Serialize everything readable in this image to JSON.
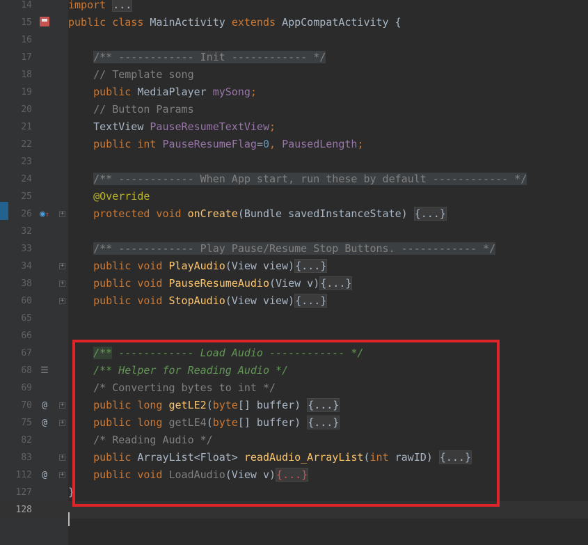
{
  "editor": {
    "colors": {
      "background": "#2b2b2b",
      "gutter": "#313335",
      "keyword": "#cc7832",
      "field": "#9876aa",
      "method": "#ffc66d",
      "comment": "#808080",
      "doc_comment": "#629755",
      "annotation": "#bbb529",
      "number": "#6897bb",
      "highlight_box": "#e0252a"
    },
    "lines": [
      {
        "num": "14",
        "segments": [
          {
            "t": "import ",
            "c": "kw"
          },
          {
            "t": "...",
            "c": "folded"
          }
        ]
      },
      {
        "num": "15",
        "icon": "vcs-class-icon",
        "segments": [
          {
            "t": "public class ",
            "c": "kw"
          },
          {
            "t": "MainActivity ",
            "c": "id"
          },
          {
            "t": "extends ",
            "c": "kw"
          },
          {
            "t": "AppCompatActivity {",
            "c": "id"
          }
        ]
      },
      {
        "num": "16",
        "segments": []
      },
      {
        "num": "17",
        "segments": [
          {
            "t": "    ",
            "c": "id"
          },
          {
            "t": "/** ------------ Init ------------ */",
            "c": "cm hl"
          }
        ]
      },
      {
        "num": "18",
        "segments": [
          {
            "t": "    ",
            "c": "id"
          },
          {
            "t": "// Template song",
            "c": "cm"
          }
        ]
      },
      {
        "num": "19",
        "segments": [
          {
            "t": "    ",
            "c": "id"
          },
          {
            "t": "public ",
            "c": "kw"
          },
          {
            "t": "MediaPlayer ",
            "c": "id"
          },
          {
            "t": "mySong",
            "c": "fld"
          },
          {
            "t": ";",
            "c": "kw"
          }
        ]
      },
      {
        "num": "20",
        "segments": [
          {
            "t": "    ",
            "c": "id"
          },
          {
            "t": "// Button Params",
            "c": "cm"
          }
        ]
      },
      {
        "num": "21",
        "segments": [
          {
            "t": "    ",
            "c": "id"
          },
          {
            "t": "TextView ",
            "c": "id"
          },
          {
            "t": "PauseResumeTextView",
            "c": "fld"
          },
          {
            "t": ";",
            "c": "kw"
          }
        ]
      },
      {
        "num": "22",
        "segments": [
          {
            "t": "    ",
            "c": "id"
          },
          {
            "t": "public int ",
            "c": "kw"
          },
          {
            "t": "PauseResumeFlag",
            "c": "fld"
          },
          {
            "t": "=",
            "c": "id"
          },
          {
            "t": "0",
            "c": "num"
          },
          {
            "t": ", ",
            "c": "kw"
          },
          {
            "t": "PausedLength",
            "c": "fld"
          },
          {
            "t": ";",
            "c": "kw"
          }
        ]
      },
      {
        "num": "23",
        "segments": []
      },
      {
        "num": "24",
        "segments": [
          {
            "t": "    ",
            "c": "id"
          },
          {
            "t": "/** ------------ When App start, run these by default ------------ */",
            "c": "cm hl"
          }
        ]
      },
      {
        "num": "25",
        "segments": [
          {
            "t": "    ",
            "c": "id"
          },
          {
            "t": "@Override",
            "c": "ann"
          }
        ]
      },
      {
        "num": "26",
        "icon": "override-up-icon",
        "fold": true,
        "segments": [
          {
            "t": "    ",
            "c": "id"
          },
          {
            "t": "protected void ",
            "c": "kw"
          },
          {
            "t": "onCreate",
            "c": "mth"
          },
          {
            "t": "(Bundle savedInstanceState) ",
            "c": "id"
          },
          {
            "t": "{...}",
            "c": "folded"
          }
        ]
      },
      {
        "num": "32",
        "segments": []
      },
      {
        "num": "33",
        "segments": [
          {
            "t": "    ",
            "c": "id"
          },
          {
            "t": "/** ------------ Play Pause/Resume Stop Buttons. ------------ */",
            "c": "cm hl"
          }
        ]
      },
      {
        "num": "34",
        "fold": true,
        "segments": [
          {
            "t": "    ",
            "c": "id"
          },
          {
            "t": "public void ",
            "c": "kw"
          },
          {
            "t": "PlayAudio",
            "c": "mth"
          },
          {
            "t": "(View view)",
            "c": "id"
          },
          {
            "t": "{...}",
            "c": "folded"
          }
        ]
      },
      {
        "num": "38",
        "fold": true,
        "segments": [
          {
            "t": "    ",
            "c": "id"
          },
          {
            "t": "public void ",
            "c": "kw"
          },
          {
            "t": "PauseResumeAudio",
            "c": "mth"
          },
          {
            "t": "(View v)",
            "c": "id"
          },
          {
            "t": "{...}",
            "c": "folded"
          }
        ]
      },
      {
        "num": "60",
        "fold": true,
        "segments": [
          {
            "t": "    ",
            "c": "id"
          },
          {
            "t": "public void ",
            "c": "kw"
          },
          {
            "t": "StopAudio",
            "c": "mth"
          },
          {
            "t": "(View view)",
            "c": "id"
          },
          {
            "t": "{...}",
            "c": "folded"
          }
        ]
      },
      {
        "num": "65",
        "segments": []
      },
      {
        "num": "66",
        "segments": []
      },
      {
        "num": "67",
        "segments": [
          {
            "t": "    ",
            "c": "id"
          },
          {
            "t": "/**",
            "c": "doc mlink"
          },
          {
            "t": " ------------ Load Audio ------------ */",
            "c": "doc"
          }
        ]
      },
      {
        "num": "68",
        "icon": "structure-icon",
        "segments": [
          {
            "t": "    ",
            "c": "id"
          },
          {
            "t": "/** Helper for Reading Audio */",
            "c": "doc"
          }
        ]
      },
      {
        "num": "69",
        "segments": [
          {
            "t": "    ",
            "c": "id"
          },
          {
            "t": "/* Converting bytes to int */",
            "c": "cm"
          }
        ]
      },
      {
        "num": "70",
        "icon": "at-icon",
        "fold": true,
        "segments": [
          {
            "t": "    ",
            "c": "id"
          },
          {
            "t": "public long ",
            "c": "kw"
          },
          {
            "t": "getLE2",
            "c": "mth"
          },
          {
            "t": "(",
            "c": "id"
          },
          {
            "t": "byte",
            "c": "kw"
          },
          {
            "t": "[] buffer) ",
            "c": "id"
          },
          {
            "t": "{...}",
            "c": "folded"
          }
        ]
      },
      {
        "num": "75",
        "icon": "at-icon",
        "fold": true,
        "segments": [
          {
            "t": "    ",
            "c": "id"
          },
          {
            "t": "public long ",
            "c": "kw"
          },
          {
            "t": "getLE4",
            "c": "unused"
          },
          {
            "t": "(",
            "c": "id"
          },
          {
            "t": "byte",
            "c": "kw"
          },
          {
            "t": "[] buffer) ",
            "c": "id"
          },
          {
            "t": "{...}",
            "c": "folded"
          }
        ]
      },
      {
        "num": "82",
        "segments": [
          {
            "t": "    ",
            "c": "id"
          },
          {
            "t": "/* Reading Audio */",
            "c": "cm"
          }
        ]
      },
      {
        "num": "83",
        "fold": true,
        "segments": [
          {
            "t": "    ",
            "c": "id"
          },
          {
            "t": "public ",
            "c": "kw"
          },
          {
            "t": "ArrayList<Float> ",
            "c": "id"
          },
          {
            "t": "readAudio_ArrayList",
            "c": "mth"
          },
          {
            "t": "(",
            "c": "id"
          },
          {
            "t": "int ",
            "c": "kw"
          },
          {
            "t": "rawID) ",
            "c": "id"
          },
          {
            "t": "{...}",
            "c": "folded"
          }
        ]
      },
      {
        "num": "112",
        "icon": "at-icon",
        "fold": true,
        "segments": [
          {
            "t": "    ",
            "c": "id"
          },
          {
            "t": "public void ",
            "c": "kw"
          },
          {
            "t": "LoadAudio",
            "c": "unused"
          },
          {
            "t": "(View v)",
            "c": "id"
          },
          {
            "t": "{...}",
            "c": "folded err"
          }
        ]
      },
      {
        "num": "127",
        "segments": [
          {
            "t": "}",
            "c": "id"
          }
        ]
      },
      {
        "num": "128",
        "current": true,
        "segments": []
      }
    ]
  }
}
